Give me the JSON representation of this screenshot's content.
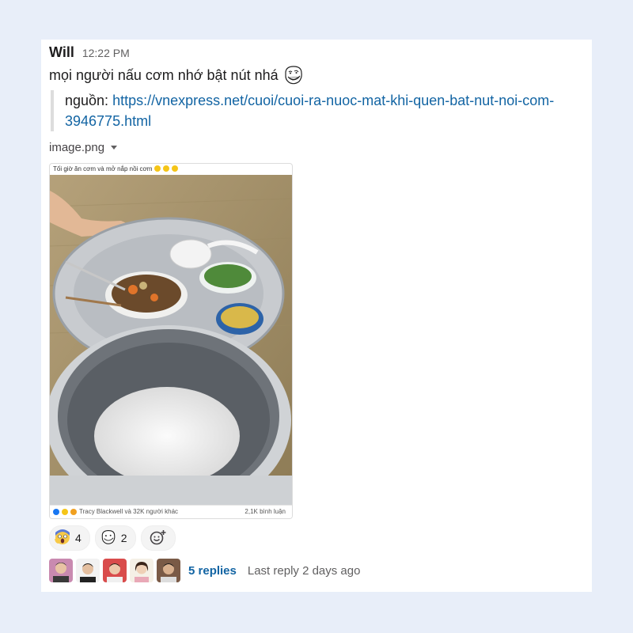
{
  "message": {
    "author": "Will",
    "time": "12:22 PM",
    "text": "mọi người nấu cơm nhớ bật nút nhá",
    "emoji": "trollface-icon",
    "quote_prefix": "nguồn: ",
    "quote_link": "https://vnexpress.net/cuoi/cuoi-ra-nuoc-mat-khi-quen-bat-nut-noi-com-3946775.html"
  },
  "attachment": {
    "filename": "image.png",
    "caption": "Tối giờ ăn cơm và mở nắp nồi cơm",
    "footer_left": "Tracy Blackwell và 32K người khác",
    "footer_right": "2,1K bình luận"
  },
  "reactions": [
    {
      "icon": "screaming-face-icon",
      "count": "4"
    },
    {
      "icon": "trollface-icon",
      "count": "2"
    }
  ],
  "thread": {
    "replies": "5 replies",
    "last_reply": "Last reply 2 days ago"
  },
  "colors": {
    "background": "#e8eef9",
    "link": "#1264a3",
    "muted": "#616061"
  }
}
